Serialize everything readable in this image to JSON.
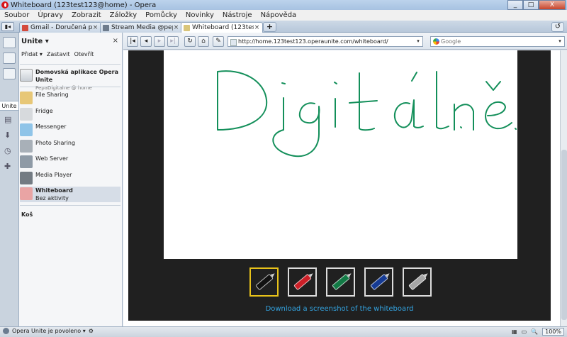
{
  "window": {
    "title": "Whiteboard (123test123@home) - Opera",
    "min": "_",
    "max": "□",
    "close": "X"
  },
  "menu": [
    "Soubor",
    "Úpravy",
    "Zobrazit",
    "Záložky",
    "Pomůcky",
    "Novinky",
    "Nástroje",
    "Nápověda"
  ],
  "tabs": [
    {
      "label": "Gmail - Doručená pošt...",
      "close": "×",
      "color": "#d44a3c"
    },
    {
      "label": "Stream Media @pepad...",
      "close": "×",
      "color": "#6d7b8c"
    },
    {
      "label": "Whiteboard (123test12...",
      "close": "×",
      "color": "#d9c57a"
    }
  ],
  "newtab": "+",
  "panel_toggle": "▮◂",
  "trash": "↺",
  "strip": {
    "unite": "Unite",
    "plus": "✚",
    "clock": "◷",
    "down": "⬇"
  },
  "panel": {
    "title": "Unite ▾",
    "close": "×",
    "actions": [
      "Přidat ▾",
      "Zastavit",
      "Otevřít"
    ],
    "home": {
      "title": "Domovská aplikace Opera Unite",
      "sub": "PepaDigitalne @ home"
    },
    "items": [
      {
        "label": "File Sharing",
        "color": "#e7c777"
      },
      {
        "label": "Fridge",
        "color": "#d7dadd"
      },
      {
        "label": "Messenger",
        "color": "#8fc4e8"
      },
      {
        "label": "Photo Sharing",
        "color": "#a8b0b8"
      },
      {
        "label": "Web Server",
        "color": "#8e9aa6"
      },
      {
        "label": "Media Player",
        "color": "#737b83"
      }
    ],
    "selected": {
      "label": "Whiteboard",
      "sub": "Bez aktivity",
      "color": "#e9a4a4"
    },
    "trash": "Koš"
  },
  "nav": {
    "first": "|◂",
    "back": "◂",
    "forward": "▸",
    "last": "▸|",
    "reload": "↻",
    "home": "⌂",
    "url": "http://home.123test123.operaunite.com/whiteboard/",
    "url_drop": "▾",
    "search_placeholder": "Google",
    "search_drop": "▾"
  },
  "whiteboard": {
    "drawing_color": "#138f5a",
    "palette": [
      {
        "color": "#111111",
        "selected": true
      },
      {
        "color": "#cc1f27",
        "selected": false
      },
      {
        "color": "#127a45",
        "selected": false
      },
      {
        "color": "#163b94",
        "selected": false
      },
      {
        "color": "#a6a6a6",
        "selected": false
      }
    ],
    "download": "Download a screenshot of the whiteboard"
  },
  "status": {
    "unite": "Opera Unite je povoleno ▾",
    "zoom": "100%"
  }
}
